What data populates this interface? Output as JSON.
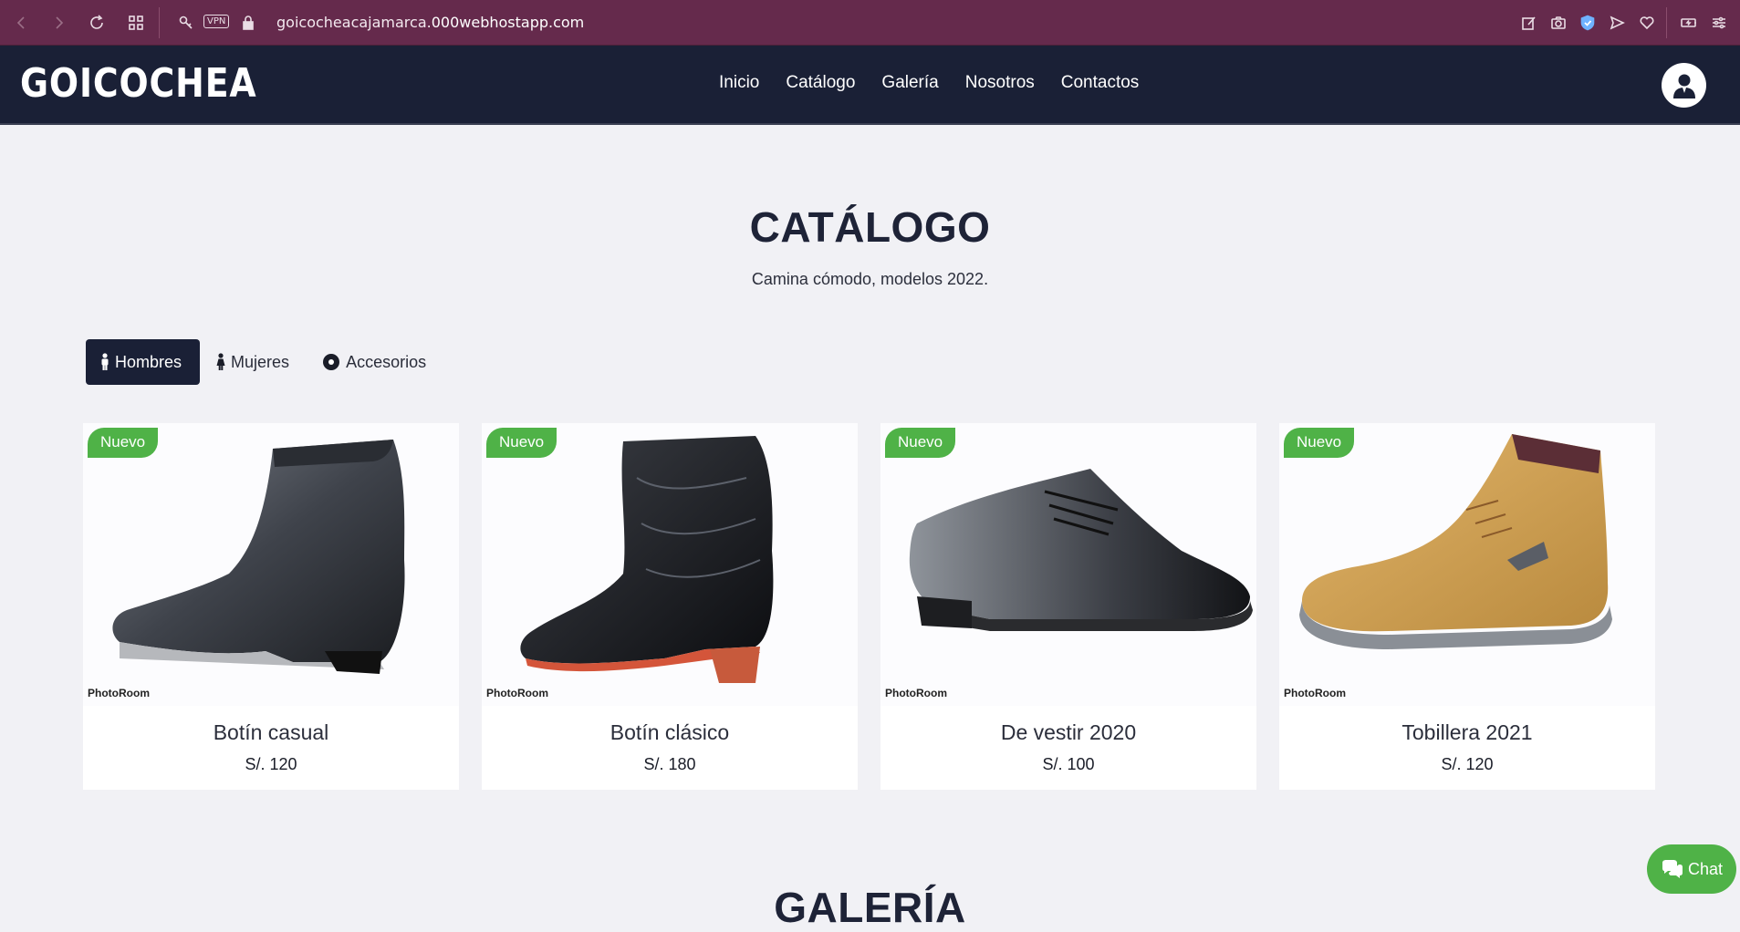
{
  "browser": {
    "url_prefix": "goicocheacajamarca.",
    "url_domain": "000webhostapp.com",
    "vpn_label": "VPN"
  },
  "header": {
    "brand": "GOICOCHEA",
    "nav": [
      "Inicio",
      "Catálogo",
      "Galería",
      "Nosotros",
      "Contactos"
    ]
  },
  "catalog": {
    "title": "CATÁLOGO",
    "subtitle": "Camina cómodo, modelos 2022.",
    "tabs": [
      "Hombres",
      "Mujeres",
      "Accesorios"
    ],
    "active_tab": "Hombres",
    "badge": "Nuevo",
    "watermark": "PhotoRoom",
    "products": [
      {
        "name": "Botín casual",
        "price": "S/. 120"
      },
      {
        "name": "Botín clásico",
        "price": "S/. 180"
      },
      {
        "name": "De vestir 2020",
        "price": "S/. 100"
      },
      {
        "name": "Tobillera 2021",
        "price": "S/. 120"
      }
    ]
  },
  "gallery": {
    "title": "GALERÍA"
  },
  "chat": {
    "label": "Chat"
  },
  "colors": {
    "browser_bar": "#652a4c",
    "header_bg": "#1a2036",
    "accent_green": "#4fb247",
    "page_bg": "#f1f1f5"
  }
}
